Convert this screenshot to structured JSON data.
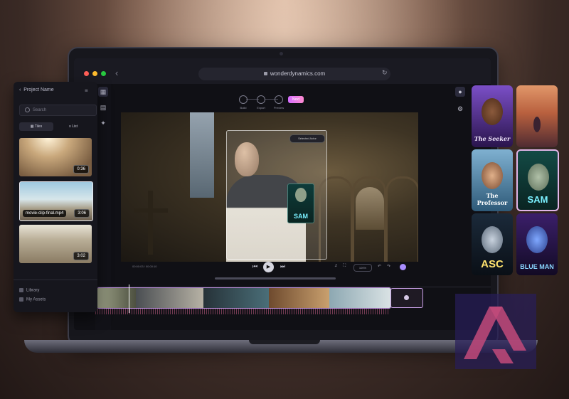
{
  "browser": {
    "url": "wonderdynamics.com"
  },
  "steps": [
    {
      "label": "Build"
    },
    {
      "label": "Export"
    },
    {
      "label": "Preview"
    }
  ],
  "next_label": "Next",
  "video": {
    "select_badge": "Selected Actor",
    "mini_character": "SAM",
    "timecode": "00:00:03 / 00:00:10",
    "zoom": "100%"
  },
  "panel": {
    "project_name": "Project Name",
    "search_placeholder": "Search",
    "tabs": [
      {
        "label": "Tiles"
      },
      {
        "label": "List"
      }
    ],
    "clips": [
      {
        "duration": "0:36",
        "filename": ""
      },
      {
        "duration": "3:06",
        "filename": "movie-clip-final.mp4"
      },
      {
        "duration": "3:02",
        "filename": ""
      }
    ],
    "nav": [
      {
        "label": "Library"
      },
      {
        "label": "My Assets"
      }
    ]
  },
  "characters": [
    {
      "name": "The Seeker"
    },
    {
      "name": ""
    },
    {
      "name": "The Professor"
    },
    {
      "name": "SAM"
    },
    {
      "name": "ASC"
    },
    {
      "name": "BLUE MAN"
    }
  ],
  "colors": {
    "accent": "#c99cf0",
    "next_button": "#e07dff",
    "sam_text": "#7af0ff"
  }
}
